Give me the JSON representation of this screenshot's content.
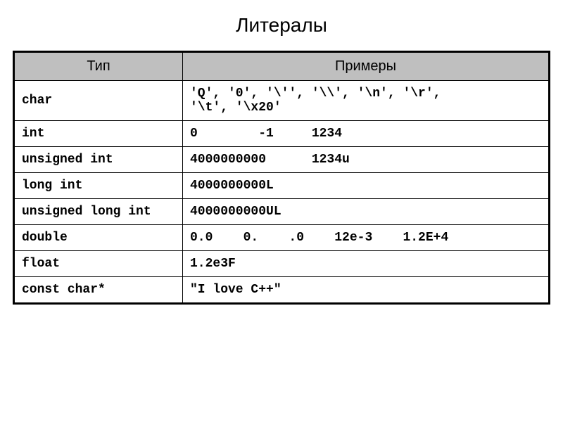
{
  "title": "Литералы",
  "headers": {
    "type": "Тип",
    "examples": "Примеры"
  },
  "rows": [
    {
      "type": "char",
      "example": "'Q', '0', '\\'', '\\\\', '\\n', '\\r',\n'\\t', '\\x20'"
    },
    {
      "type": "int",
      "example": "0        -1     1234"
    },
    {
      "type": "unsigned int",
      "example": "4000000000      1234u"
    },
    {
      "type": "long int",
      "example": "4000000000L"
    },
    {
      "type": "unsigned long int",
      "example": "4000000000UL"
    },
    {
      "type": "double",
      "example": "0.0    0.    .0    12e-3    1.2E+4"
    },
    {
      "type": "float",
      "example": "1.2e3F"
    },
    {
      "type": "const char*",
      "example": "\"I love C++\""
    }
  ]
}
